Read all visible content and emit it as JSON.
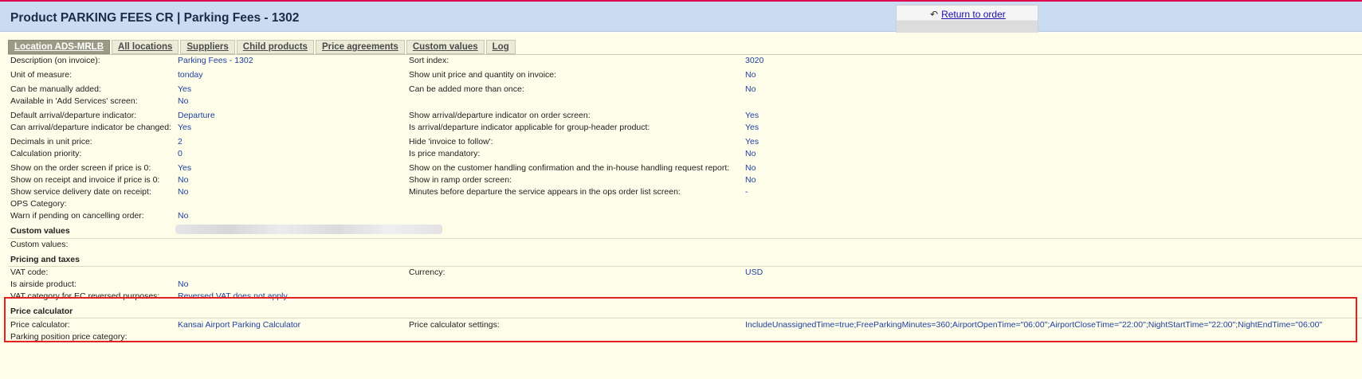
{
  "header": {
    "title": "Product PARKING FEES CR | Parking Fees - 1302",
    "return_link": "Return to order"
  },
  "tabs": [
    {
      "label": "Location ADS-MRLB",
      "active": true
    },
    {
      "label": "All locations"
    },
    {
      "label": "Suppliers"
    },
    {
      "label": "Child products"
    },
    {
      "label": "Price agreements"
    },
    {
      "label": "Custom values"
    },
    {
      "label": "Log"
    }
  ],
  "fields": {
    "description_label": "Description (on invoice):",
    "description_value": "Parking Fees - 1302",
    "sort_index_label": "Sort index:",
    "sort_index_value": "3020",
    "unit_of_measure_label": "Unit of measure:",
    "unit_of_measure_value": "tonday",
    "show_unit_price_label": "Show unit price and quantity on invoice:",
    "show_unit_price_value": "No",
    "manually_added_label": "Can be manually added:",
    "manually_added_value": "Yes",
    "added_more_than_once_label": "Can be added more than once:",
    "added_more_than_once_value": "No",
    "available_add_services_label": "Available in 'Add Services' screen:",
    "available_add_services_value": "No",
    "default_arr_dep_label": "Default arrival/departure indicator:",
    "default_arr_dep_value": "Departure",
    "show_arr_dep_order_label": "Show arrival/departure indicator on order screen:",
    "show_arr_dep_order_value": "Yes",
    "arr_dep_changed_label": "Can arrival/departure indicator be changed:",
    "arr_dep_changed_value": "Yes",
    "arr_dep_group_header_label": "Is arrival/departure indicator applicable for group-header product:",
    "arr_dep_group_header_value": "Yes",
    "decimals_label": "Decimals in unit price:",
    "decimals_value": "2",
    "hide_invoice_label": "Hide 'invoice to follow':",
    "hide_invoice_value": "Yes",
    "calc_priority_label": "Calculation priority:",
    "calc_priority_value": "0",
    "price_mandatory_label": "Is price mandatory:",
    "price_mandatory_value": "No",
    "show_order_price0_label": "Show on the order screen if price is 0:",
    "show_order_price0_value": "Yes",
    "show_customer_handling_label": "Show on the customer handling confirmation and the in-house handling request report:",
    "show_customer_handling_value": "No",
    "show_receipt_price0_label": "Show on receipt and invoice if price is 0:",
    "show_receipt_price0_value": "No",
    "show_ramp_label": "Show in ramp order screen:",
    "show_ramp_value": "No",
    "show_delivery_date_label": "Show service delivery date on receipt:",
    "show_delivery_date_value": "No",
    "minutes_before_label": "Minutes before departure the service appears in the ops order list screen:",
    "minutes_before_value": "-",
    "ops_category_label": "OPS Category:",
    "warn_pending_label": "Warn if pending on cancelling order:",
    "warn_pending_value": "No"
  },
  "custom_values": {
    "section_title": "Custom values",
    "label": "Custom values:"
  },
  "pricing": {
    "section_title": "Pricing and taxes",
    "vat_code_label": "VAT code:",
    "currency_label": "Currency:",
    "currency_value": "USD",
    "airside_label": "Is airside product:",
    "airside_value": "No",
    "vat_category_label": "VAT category for EC reversed purposes:",
    "vat_category_value": "Reversed VAT does not apply"
  },
  "price_calculator": {
    "section_title": "Price calculator",
    "calculator_label": "Price calculator:",
    "calculator_value": "Kansai Airport Parking Calculator",
    "settings_label": "Price calculator settings:",
    "settings_value": "IncludeUnassignedTime=true;FreeParkingMinutes=360;AirportOpenTime=\"06:00\";AirportCloseTime=\"22:00\";NightStartTime=\"22:00\";NightEndTime=\"06:00\"",
    "parking_category_label": "Parking position price category:"
  },
  "colors": {
    "header_bg": "#c9dcf1",
    "content_bg": "#fdfde9",
    "value_text": "#2140a0",
    "highlight_border": "#e52020",
    "active_tab_bg": "#9b9b85"
  },
  "icons": {
    "return": "undo-arrow-icon"
  }
}
